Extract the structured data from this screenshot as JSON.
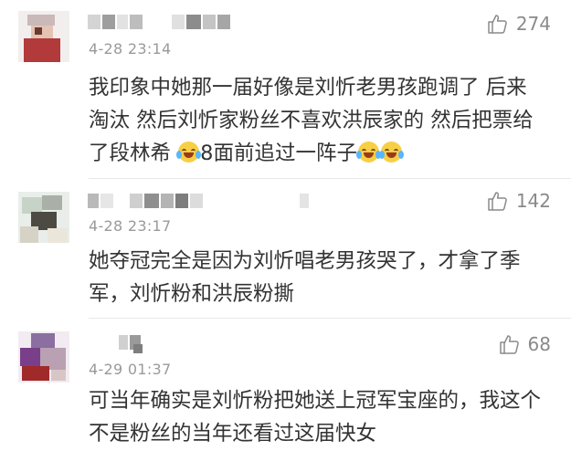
{
  "comments": [
    {
      "time": "4-28 23:14",
      "likes": "274",
      "text_before_emoji": "我印象中她那一届好像是刘忻老男孩跑调了 后来淘汰 然后刘忻家粉丝不喜欢洪辰家的 然后把票给了段林希 ",
      "text_middle": "8面前追过一阵子",
      "emoji_name": "cry-laugh-emoji"
    },
    {
      "time": "4-28 23:17",
      "likes": "142",
      "text": "她夺冠完全是因为刘忻唱老男孩哭了，才拿了季军，刘忻粉和洪辰粉撕"
    },
    {
      "time": "4-29 01:37",
      "likes": "68",
      "text": "可当年确实是刘忻粉把她送上冠军宝座的，我这个不是粉丝的当年还看过这届快女"
    }
  ],
  "colors": {
    "text": "#333333",
    "meta": "#9a9a9a",
    "like": "#8a8a8a",
    "divider": "#e8e8e8"
  }
}
